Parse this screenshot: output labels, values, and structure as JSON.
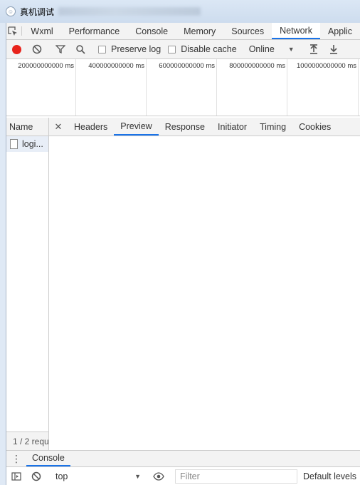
{
  "window": {
    "title": "真机调试"
  },
  "main_tabs": [
    {
      "label": "Wxml"
    },
    {
      "label": "Performance"
    },
    {
      "label": "Console"
    },
    {
      "label": "Memory"
    },
    {
      "label": "Sources"
    },
    {
      "label": "Network",
      "active": true
    },
    {
      "label": "Applic"
    }
  ],
  "network_toolbar": {
    "preserve_log": "Preserve log",
    "disable_cache": "Disable cache",
    "throttle": "Online"
  },
  "overview": {
    "ticks": [
      "200000000000 ms",
      "400000000000 ms",
      "600000000000 ms",
      "800000000000 ms",
      "1000000000000 ms"
    ]
  },
  "requests": {
    "header": "Name",
    "rows": [
      {
        "name": "logi..."
      }
    ],
    "footer": "1 / 2 requ"
  },
  "detail_tabs": [
    {
      "label": "Headers"
    },
    {
      "label": "Preview",
      "active": true
    },
    {
      "label": "Response"
    },
    {
      "label": "Initiator"
    },
    {
      "label": "Timing"
    },
    {
      "label": "Cookies"
    }
  ],
  "drawer": {
    "tab": "Console",
    "context": "top",
    "filter_placeholder": "Filter",
    "levels": "Default levels"
  }
}
